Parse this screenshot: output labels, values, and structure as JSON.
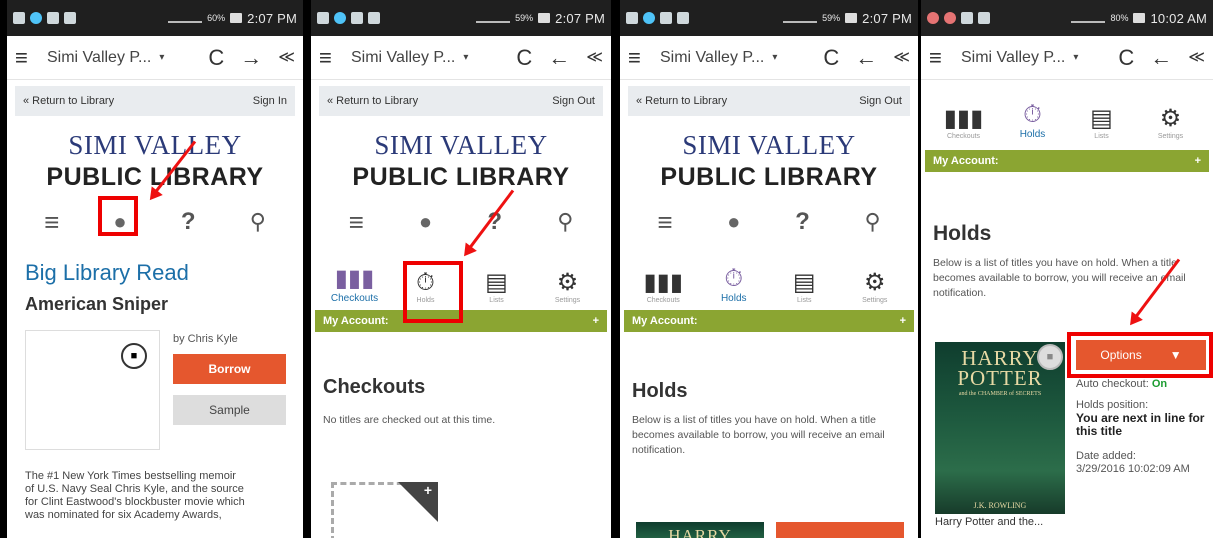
{
  "status": {
    "time_a": "2:07 PM",
    "time_b": "10:02 AM",
    "battery_a": "60%",
    "battery_b": "59%",
    "battery_c": "80%"
  },
  "browser": {
    "url": "Simi Valley P...",
    "menu_icon": "≡",
    "caret": "▾",
    "refresh": "C",
    "forward": "→",
    "back": "←",
    "share": "≪"
  },
  "topbar": {
    "return_label": "« Return to Library",
    "sign_in": "Sign In",
    "sign_out": "Sign Out"
  },
  "logo": {
    "line1": "SIMI VALLEY",
    "line2": "PUBLIC LIBRARY"
  },
  "nav": {
    "menu": "≡",
    "account": "👤",
    "help": "?",
    "search": "🔍"
  },
  "panel1": {
    "section": "Big Library Read",
    "title": "American Sniper",
    "author": "by Chris Kyle",
    "borrow": "Borrow",
    "sample": "Sample",
    "desc_lines": [
      "The #1 New York Times bestselling memoir",
      "of U.S. Navy Seal Chris Kyle, and the source",
      "for Clint Eastwood's blockbuster movie which",
      "was nominated for six Academy Awards,"
    ]
  },
  "tabs": {
    "checkouts": "Checkouts",
    "holds": "Holds",
    "lists": "Lists",
    "settings": "Settings"
  },
  "account_bar": {
    "label": "My Account:",
    "plus": "+"
  },
  "panel2": {
    "heading": "Checkouts",
    "text": "No titles are checked out at this time."
  },
  "panel3": {
    "heading": "Holds",
    "text": "Below is a list of titles you have on hold. When a title becomes available to borrow, you will receive an email notification."
  },
  "panel4": {
    "heading": "Holds",
    "text": "Below is a list of titles you have on hold. When a title becomes available to borrow, you will receive an email notification.",
    "options": "Options",
    "auto_checkout_label": "Auto checkout:",
    "auto_checkout_value": "On",
    "holds_position_label": "Holds position:",
    "holds_position_value": "You are next in line for this title",
    "date_added_label": "Date added:",
    "date_added_value": "3/29/2016 10:02:09 AM",
    "book_caption": "Harry Potter and the...",
    "cover_title": "HARRY POTTER",
    "cover_subtitle": "and the CHAMBER of SECRETS",
    "cover_author": "J.K. ROWLING"
  }
}
